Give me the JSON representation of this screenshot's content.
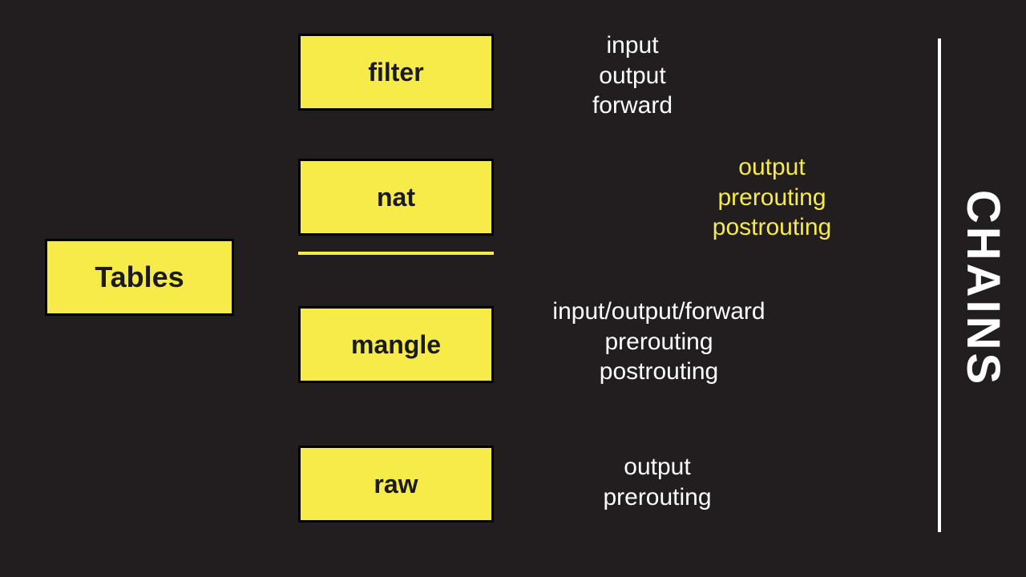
{
  "root_label": "Tables",
  "side_label": "CHAINS",
  "tables": {
    "filter": {
      "name": "filter",
      "chains": [
        "input",
        "output",
        "forward"
      ],
      "highlight": false
    },
    "nat": {
      "name": "nat",
      "chains": [
        "output",
        "prerouting",
        "postrouting"
      ],
      "highlight": true
    },
    "mangle": {
      "name": "mangle",
      "chains": [
        "input/output/forward",
        "prerouting",
        "postrouting"
      ],
      "highlight": false
    },
    "raw": {
      "name": "raw",
      "chains": [
        "output",
        "prerouting"
      ],
      "highlight": false
    }
  },
  "colors": {
    "background": "#221e1f",
    "box_fill": "#f7eb49",
    "box_border": "#000000",
    "text_dark": "#1b1b1b",
    "text_light": "#ffffff",
    "highlight": "#f7eb49"
  }
}
